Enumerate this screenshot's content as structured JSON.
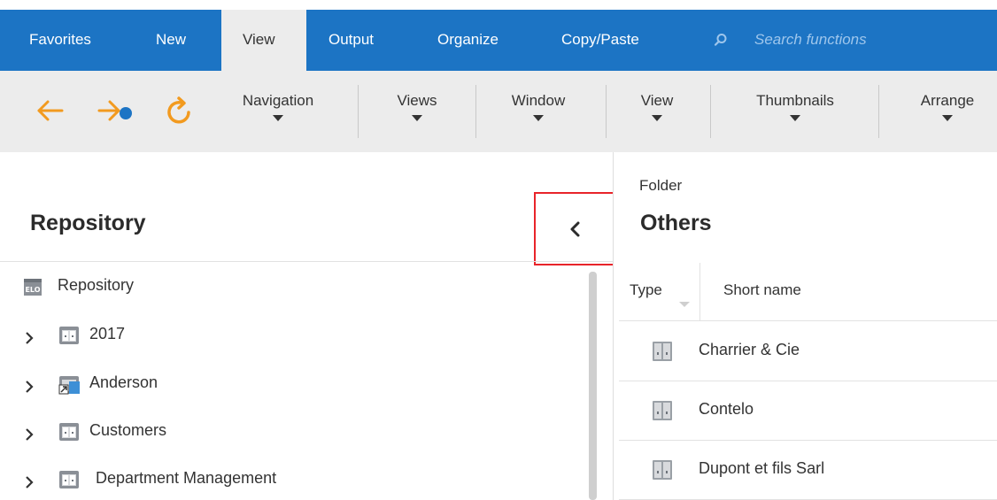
{
  "ribbon": {
    "tabs": [
      {
        "label": "Favorites",
        "active": false
      },
      {
        "label": "New",
        "active": false
      },
      {
        "label": "View",
        "active": true
      },
      {
        "label": "Output",
        "active": false
      },
      {
        "label": "Organize",
        "active": false
      },
      {
        "label": "Copy/Paste",
        "active": false
      }
    ],
    "search": {
      "placeholder": "Search functions",
      "icon": "search-icon"
    }
  },
  "toolbar": {
    "nav_icons": [
      "back-arrow-icon",
      "forward-arrow-icon",
      "refresh-icon"
    ],
    "menus": [
      {
        "label": "Navigation"
      },
      {
        "label": "Views"
      },
      {
        "label": "Window"
      },
      {
        "label": "View"
      },
      {
        "label": "Thumbnails"
      },
      {
        "label": "Arrange"
      }
    ]
  },
  "repository_panel": {
    "title": "Repository",
    "collapse_icon": "chevron-left-icon",
    "tree": [
      {
        "label": "Repository",
        "icon": "repository-icon",
        "expandable": false
      },
      {
        "label": "2017",
        "icon": "cabinet-icon",
        "expandable": true
      },
      {
        "label": "Anderson",
        "icon": "linked-folder-icon",
        "expandable": true
      },
      {
        "label": "Customers",
        "icon": "cabinet-icon",
        "expandable": true
      },
      {
        "label": "Department Management",
        "icon": "cabinet-icon",
        "expandable": true
      }
    ]
  },
  "folder_panel": {
    "caption": "Folder",
    "title": "Others",
    "columns": {
      "type": "Type",
      "short_name": "Short name"
    },
    "rows": [
      {
        "short_name": "Charrier & Cie",
        "icon": "folder-icon"
      },
      {
        "short_name": "Contelo",
        "icon": "folder-icon"
      },
      {
        "short_name": "Dupont et fils Sarl",
        "icon": "folder-icon"
      }
    ]
  },
  "colors": {
    "ribbon_blue": "#1c74c4",
    "toolbar_gray": "#ececec",
    "accent_orange": "#f29a1f",
    "highlight_red": "#e8242a"
  }
}
